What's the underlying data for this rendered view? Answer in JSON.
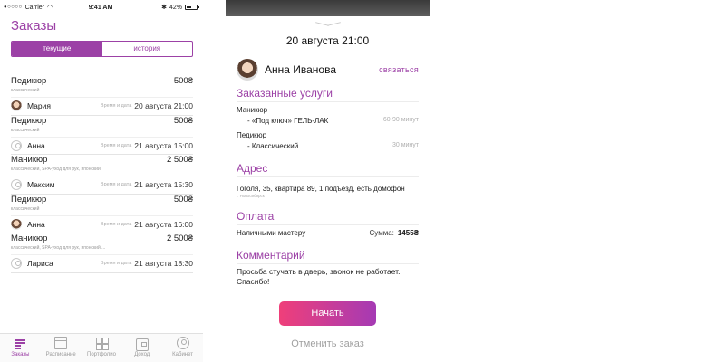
{
  "status": {
    "signal": "●○○○○",
    "carrier": "Carrier",
    "time": "9:41 AM",
    "bluetooth": "✱",
    "battery_text": "42%"
  },
  "orders_screen": {
    "title": "Заказы",
    "segments": [
      "текущие",
      "история"
    ],
    "date_label": "Время и дата",
    "orders": [
      {
        "service": "Педикюр",
        "price": "500₴",
        "details": "классический",
        "client": "Мария",
        "avatar": "photo",
        "datetime": "20 августа 21:00"
      },
      {
        "service": "Педикюр",
        "price": "500₴",
        "details": "классический",
        "client": "Анна",
        "avatar": "empty",
        "datetime": "21 августа 15:00"
      },
      {
        "service": "Маникюр",
        "price": "2 500₴",
        "details": "классический, SPA-уход для рук, японский",
        "client": "Максим",
        "avatar": "empty",
        "datetime": "21 августа 15:30"
      },
      {
        "service": "Педикюр",
        "price": "500₴",
        "details": "классический",
        "client": "Анна",
        "avatar": "photo",
        "datetime": "21 августа 16:00"
      },
      {
        "service": "Маникюр",
        "price": "2 500₴",
        "details": "классический, SPA-уход для рук, японский ...",
        "client": "Лариса",
        "avatar": "empty",
        "datetime": "21 августа 18:30"
      }
    ],
    "tabs": [
      {
        "label": "Заказы",
        "icon": "list-icon"
      },
      {
        "label": "Расписание",
        "icon": "calendar-icon"
      },
      {
        "label": "Портфолио",
        "icon": "grid-icon"
      },
      {
        "label": "Доход",
        "icon": "wallet-icon"
      },
      {
        "label": "Кабинет",
        "icon": "user-icon"
      }
    ]
  },
  "detail_screen": {
    "date_title": "20 августа 21:00",
    "client_name": "Анна Иванова",
    "contact_label": "связаться",
    "services_title": "Заказанные услуги",
    "service_groups": [
      {
        "name": "Маникюр",
        "items": [
          {
            "name": "- «Под ключ» ГЕЛЬ-ЛАК",
            "duration": "60-90 минут"
          }
        ]
      },
      {
        "name": "Педикюр",
        "items": [
          {
            "name": "- Классический",
            "duration": "30 минут"
          }
        ]
      }
    ],
    "address_title": "Адрес",
    "address": "Гоголя, 35, квартира 89, 1 подъезд, есть домофон",
    "city": "г. Новосибирск",
    "payment_title": "Оплата",
    "payment_method": "Наличными мастеру",
    "sum_label": "Сумма:",
    "sum_value": "1455₴",
    "comment_title": "Комментарий",
    "comment": "Просьба стучать в дверь, звонок не работает. Спасибо!",
    "start_button": "Начать",
    "cancel_button": "Отменить заказ"
  },
  "colors": {
    "accent": "#9c41a6",
    "button_gradient_start": "#ef3f7a",
    "button_gradient_end": "#a53ab4"
  }
}
